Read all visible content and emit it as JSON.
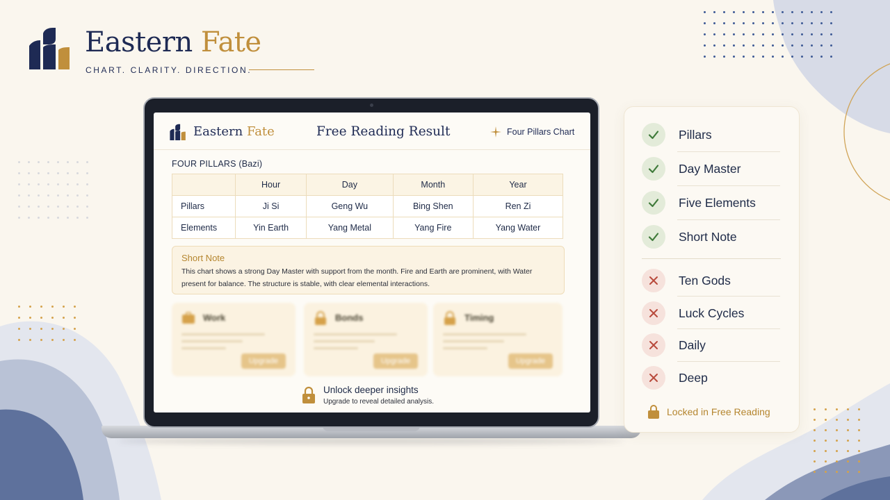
{
  "brand": {
    "name_part1": "Eastern",
    "name_part2": "Fate",
    "tagline": "CHART. CLARITY. DIRECTION."
  },
  "screen": {
    "brand_part1": "Eastern",
    "brand_part2": "Fate",
    "title": "Free Reading Result",
    "chart_chip": "Four Pillars Chart",
    "section_label": "FOUR PILLARS (Bazi)",
    "table": {
      "columns": [
        "",
        "Hour",
        "Day",
        "Month",
        "Year"
      ],
      "rows": [
        {
          "label": "Pillars",
          "cells": [
            "Ji Si",
            "Geng Wu",
            "Bing Shen",
            "Ren Zi"
          ]
        },
        {
          "label": "Elements",
          "cells": [
            "Yin Earth",
            "Yang Metal",
            "Yang Fire",
            "Yang Water"
          ]
        }
      ]
    },
    "note": {
      "title": "Short Note",
      "text": "This chart shows a strong Day Master with support from the month. Fire and Earth are prominent, with Water present for balance. The structure is stable, with clear elemental interactions."
    },
    "cards": [
      {
        "title": "Work",
        "button": "Upgrade",
        "icon": "briefcase-icon"
      },
      {
        "title": "Bonds",
        "button": "Upgrade",
        "icon": "lock-icon"
      },
      {
        "title": "Timing",
        "button": "Upgrade",
        "icon": "lock-icon"
      }
    ],
    "unlock": {
      "title": "Unlock deeper insights",
      "subtitle": "Upgrade to reveal detailed analysis."
    }
  },
  "features": {
    "included": [
      "Pillars",
      "Day Master",
      "Five Elements",
      "Short Note"
    ],
    "locked": [
      "Ten Gods",
      "Luck Cycles",
      "Daily",
      "Deep"
    ],
    "locked_label": "Locked in Free Reading"
  },
  "colors": {
    "navy": "#1e2a54",
    "gold": "#c08f3c",
    "check_green": "#3f7a3a",
    "cross_red": "#b84a3c"
  }
}
